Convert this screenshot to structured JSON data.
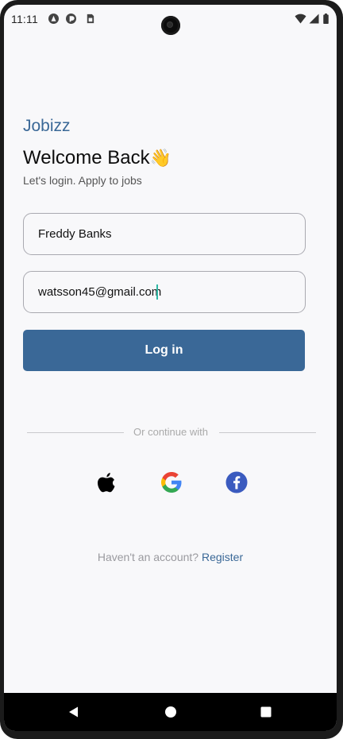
{
  "status_bar": {
    "time": "11:11"
  },
  "app": {
    "brand": "Jobizz",
    "welcome_title": "Welcome Back",
    "welcome_emoji": "👋",
    "subtitle": "Let's login. Apply to jobs"
  },
  "form": {
    "name_value": "Freddy Banks",
    "email_value": "watsson45@gmail.com",
    "login_label": "Log in"
  },
  "social": {
    "divider_text": "Or continue with",
    "providers": [
      "apple-icon",
      "google-icon",
      "facebook-icon"
    ]
  },
  "register": {
    "prompt": "Haven't an account?",
    "link": "Register"
  },
  "colors": {
    "brand": "#3a6897",
    "background": "#f8f8fa",
    "facebook": "#3b5bbf"
  }
}
